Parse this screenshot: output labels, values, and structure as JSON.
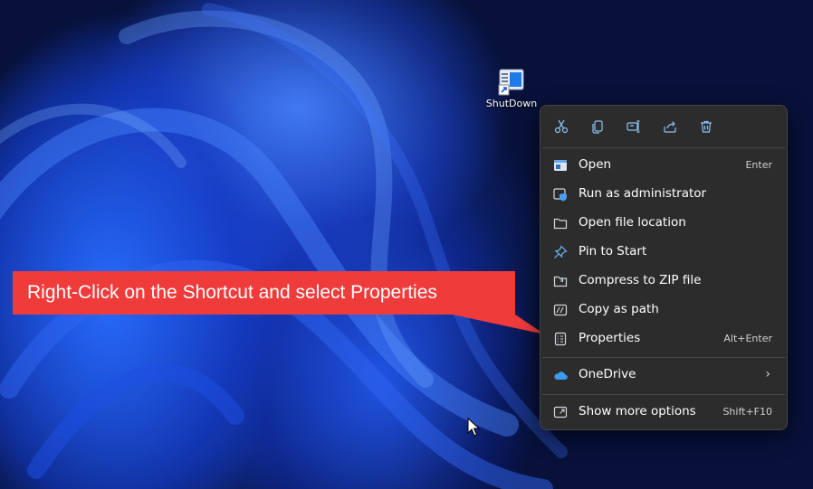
{
  "desktop_icon": {
    "label": "ShutDown",
    "icon": "shortcut-icon"
  },
  "context_menu": {
    "toolbar": [
      {
        "name": "cut-icon"
      },
      {
        "name": "copy-icon"
      },
      {
        "name": "rename-icon"
      },
      {
        "name": "share-icon"
      },
      {
        "name": "delete-icon"
      }
    ],
    "items": [
      {
        "label": "Open",
        "shortcut": "Enter",
        "icon": "open-icon"
      },
      {
        "label": "Run as administrator",
        "shortcut": "",
        "icon": "admin-shield-icon"
      },
      {
        "label": "Open file location",
        "shortcut": "",
        "icon": "folder-icon"
      },
      {
        "label": "Pin to Start",
        "shortcut": "",
        "icon": "pin-icon"
      },
      {
        "label": "Compress to ZIP file",
        "shortcut": "",
        "icon": "zip-folder-icon"
      },
      {
        "label": "Copy as path",
        "shortcut": "",
        "icon": "path-icon"
      },
      {
        "label": "Properties",
        "shortcut": "Alt+Enter",
        "icon": "properties-icon"
      }
    ],
    "onedrive": {
      "label": "OneDrive",
      "icon": "onedrive-cloud-icon",
      "chevron": "chevron-right-icon"
    },
    "more": {
      "label": "Show more options",
      "shortcut": "Shift+F10",
      "icon": "more-options-icon"
    }
  },
  "callout": {
    "text": "Right-Click on the Shortcut and select Properties",
    "color": "#f03b3b"
  },
  "colors": {
    "menu_bg": "#2c2c2c",
    "accent": "#5aa6f0"
  }
}
